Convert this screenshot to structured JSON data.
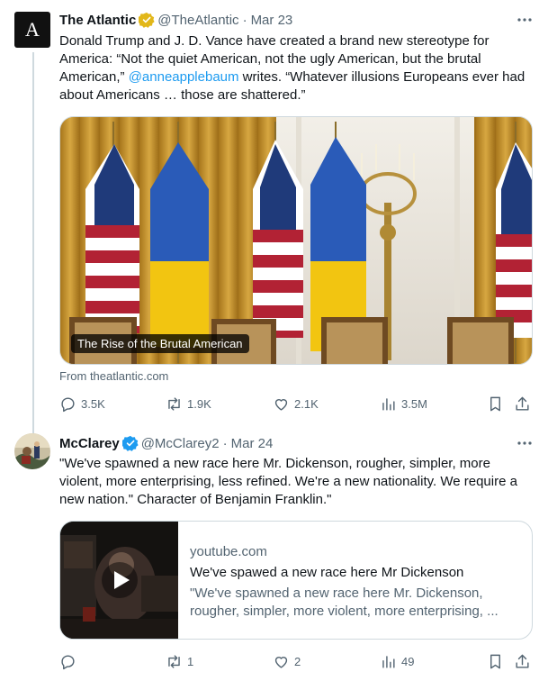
{
  "tweets": [
    {
      "avatar_letter": "A",
      "name": "The Atlantic",
      "handle": "@TheAtlantic",
      "separator": "·",
      "date": "Mar 23",
      "verified_color": "#e2b719",
      "text_before": "Donald Trump and J. D. Vance have created a brand new stereotype for America: “Not the quiet American, not the ugly American, but the brutal American,” ",
      "mention": "@anneapplebaum",
      "text_after": " writes. “Whatever illusions Europeans ever had about Americans … those are shattered.”",
      "card": {
        "caption": "The Rise of the Brutal American",
        "from": "From theatlantic.com"
      },
      "actions": {
        "replies": "3.5K",
        "reposts": "1.9K",
        "likes": "2.1K",
        "views": "3.5M"
      }
    },
    {
      "name": "McClarey",
      "handle": "@McClarey2",
      "separator": "·",
      "date": "Mar 24",
      "verified_color": "#1d9bf0",
      "text": "\"We've spawned a new race here Mr. Dickenson, rougher, simpler, more violent, more enterprising, less refined. We're a new nationality. We require a new nation.\" Character of Benjamin Franklin.\"",
      "card": {
        "domain": "youtube.com",
        "title": "We've spawed a new race here Mr Dickenson",
        "description": "\"We've spawned a new race here Mr. Dickenson, rougher, simpler, more violent, more enterprising, ..."
      },
      "actions": {
        "replies": "",
        "reposts": "1",
        "likes": "2",
        "views": "49"
      }
    }
  ],
  "colors": {
    "text": "#0f1419",
    "secondary": "#536471",
    "link": "#1d9bf0",
    "divider": "#cfd9de"
  },
  "icons": [
    "more-icon",
    "reply-icon",
    "repost-icon",
    "like-icon",
    "views-icon",
    "bookmark-icon",
    "share-icon",
    "play-icon",
    "verified-badge-icon"
  ]
}
